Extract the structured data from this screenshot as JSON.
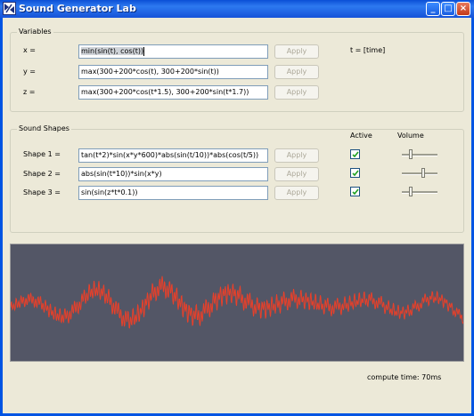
{
  "window": {
    "title": "Sound Generator Lab",
    "icon": "app-logo-icon"
  },
  "variables": {
    "group_title": "Variables",
    "time_label": "t = [time]",
    "rows": [
      {
        "label": "x =",
        "expression": "min(sin(t), cos(t))",
        "apply_label": "Apply"
      },
      {
        "label": "y =",
        "expression": "max(300+200*cos(t), 300+200*sin(t))",
        "apply_label": "Apply"
      },
      {
        "label": "z =",
        "expression": "max(300+200*cos(t*1.5), 300+200*sin(t*1.7))",
        "apply_label": "Apply"
      }
    ]
  },
  "sound_shapes": {
    "group_title": "Sound Shapes",
    "active_header": "Active",
    "volume_header": "Volume",
    "rows": [
      {
        "label": "Shape 1 =",
        "expression": "tan(t*2)*sin(x*y*600)*abs(sin(t/10))*abs(cos(t/5))",
        "apply_label": "Apply",
        "active": true,
        "volume": 0.25
      },
      {
        "label": "Shape 2 =",
        "expression": "abs(sin(t*10))*sin(x*y)",
        "apply_label": "Apply",
        "active": true,
        "volume": 0.6
      },
      {
        "label": "Shape 3 =",
        "expression": "sin(sin(z*t*0.1))",
        "apply_label": "Apply",
        "active": true,
        "volume": 0.25
      }
    ]
  },
  "waveform": {
    "background": "#535666",
    "line_color": "#e8402a"
  },
  "status": {
    "compute_time": "compute time: 70ms"
  }
}
